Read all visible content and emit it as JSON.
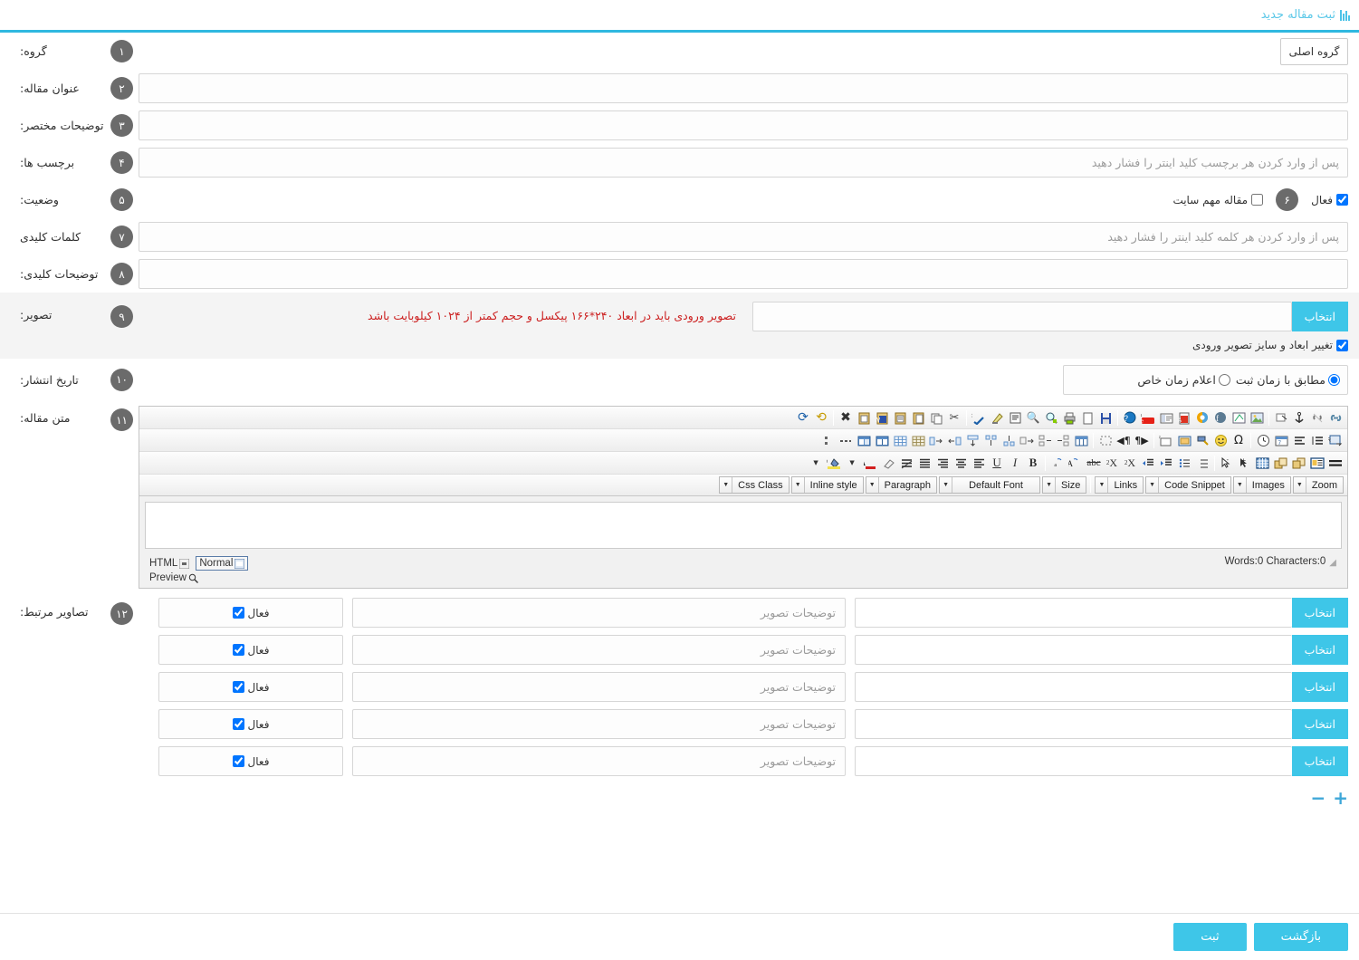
{
  "header": {
    "title": "ثبت مقاله جدید",
    "icon": "bar-chart-icon",
    "accent_color": "#2fb8e0"
  },
  "form": {
    "group": {
      "badge": "۱",
      "label": "گروه:",
      "selected": "گروه اصلی"
    },
    "title": {
      "badge": "۲",
      "label": "عنوان مقاله:",
      "value": "",
      "placeholder": ""
    },
    "short_desc": {
      "badge": "۳",
      "label": "توضیحات مختصر:",
      "value": "",
      "placeholder": ""
    },
    "tags": {
      "badge": "۴",
      "label": "برچسب ها:",
      "value": "",
      "placeholder": "پس از وارد کردن هر برچسب کلید اینتر را فشار دهید"
    },
    "status": {
      "badge": "۵",
      "label": "وضعیت:",
      "active_label": "فعال",
      "active_checked": true,
      "important_badge": "۶",
      "important_label": "مقاله مهم سایت",
      "important_checked": false
    },
    "keywords": {
      "badge": "۷",
      "label": "کلمات کلیدی",
      "value": "",
      "placeholder": "پس از وارد کردن هر کلمه کلید اینتر را فشار دهید"
    },
    "keyword_desc": {
      "badge": "۸",
      "label": "توضیحات کلیدی:",
      "value": "",
      "placeholder": ""
    },
    "image": {
      "badge": "۹",
      "label": "تصویر:",
      "pick_button": "انتخاب",
      "value": "",
      "warning": "تصویر ورودی باید در ابعاد ۲۴۰*۱۶۶ پیکسل و حجم کمتر از ۱۰۲۴ کیلوبایت باشد",
      "resize_label": "تغییر ابعاد و سایز تصویر ورودی",
      "resize_checked": true
    },
    "publish_date": {
      "badge": "۱۰",
      "label": "تاریخ انتشار:",
      "option_now": "مطابق با زمان ثبت",
      "option_custom": "اعلام زمان خاص",
      "selected": "option_now"
    },
    "body": {
      "badge": "۱۱",
      "label": "متن مقاله:"
    },
    "related": {
      "badge": "۱۲",
      "label": "تصاویر مرتبط:",
      "pick_button": "انتخاب",
      "desc_placeholder": "توضیحات تصویر",
      "active_label": "فعال",
      "add_label": "+",
      "remove_label": "−",
      "rows": [
        {
          "value": "",
          "desc": "",
          "active": true
        },
        {
          "value": "",
          "desc": "",
          "active": true
        },
        {
          "value": "",
          "desc": "",
          "active": true
        },
        {
          "value": "",
          "desc": "",
          "active": true
        },
        {
          "value": "",
          "desc": "",
          "active": true
        }
      ]
    }
  },
  "editor": {
    "dropdowns": [
      {
        "label": "Css Class"
      },
      {
        "label": "Inline style"
      },
      {
        "label": "Paragraph"
      },
      {
        "label": "Default Font"
      },
      {
        "label": "Size"
      },
      {
        "label": "Links"
      },
      {
        "label": "Code Snippet"
      },
      {
        "label": "Images"
      },
      {
        "label": "Zoom"
      }
    ],
    "content": "",
    "word_count": "Words:0 Characters:0",
    "mode_html": "HTML",
    "mode_normal": "Normal",
    "preview": "Preview",
    "active_mode": "Normal"
  },
  "footer": {
    "submit": "ثبت",
    "back": "بازگشت"
  },
  "colors": {
    "accent": "#3ec6e8",
    "badge": "#6b6b6b",
    "warning": "#cc2222",
    "shaded": "#f4f4f4"
  }
}
